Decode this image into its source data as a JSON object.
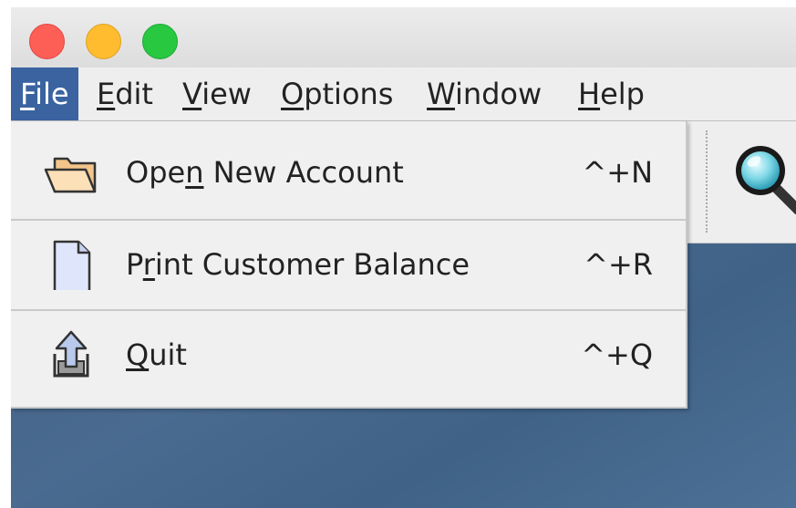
{
  "menubar": {
    "items": [
      {
        "pre": "",
        "u": "F",
        "post": "ile"
      },
      {
        "pre": "",
        "u": "E",
        "post": "dit"
      },
      {
        "pre": "",
        "u": "V",
        "post": "iew"
      },
      {
        "pre": "",
        "u": "O",
        "post": "ptions"
      },
      {
        "pre": "",
        "u": "W",
        "post": "indow"
      },
      {
        "pre": "",
        "u": "H",
        "post": "elp"
      }
    ]
  },
  "file_menu": {
    "items": [
      {
        "pre": "Ope",
        "u": "n",
        "post": " New Account",
        "accel": "^+N",
        "icon": "folder-icon"
      },
      {
        "pre": "P",
        "u": "r",
        "post": "int Customer Balance",
        "accel": "^+R",
        "icon": "document-icon"
      },
      {
        "pre": "",
        "u": "Q",
        "post": "uit",
        "accel": "^+Q",
        "icon": "exit-upload-icon"
      }
    ]
  },
  "toolbar": {
    "icon": "magnifier-icon"
  },
  "colors": {
    "menu_highlight": "#3a63a0",
    "desktop": "#4a6b90"
  }
}
